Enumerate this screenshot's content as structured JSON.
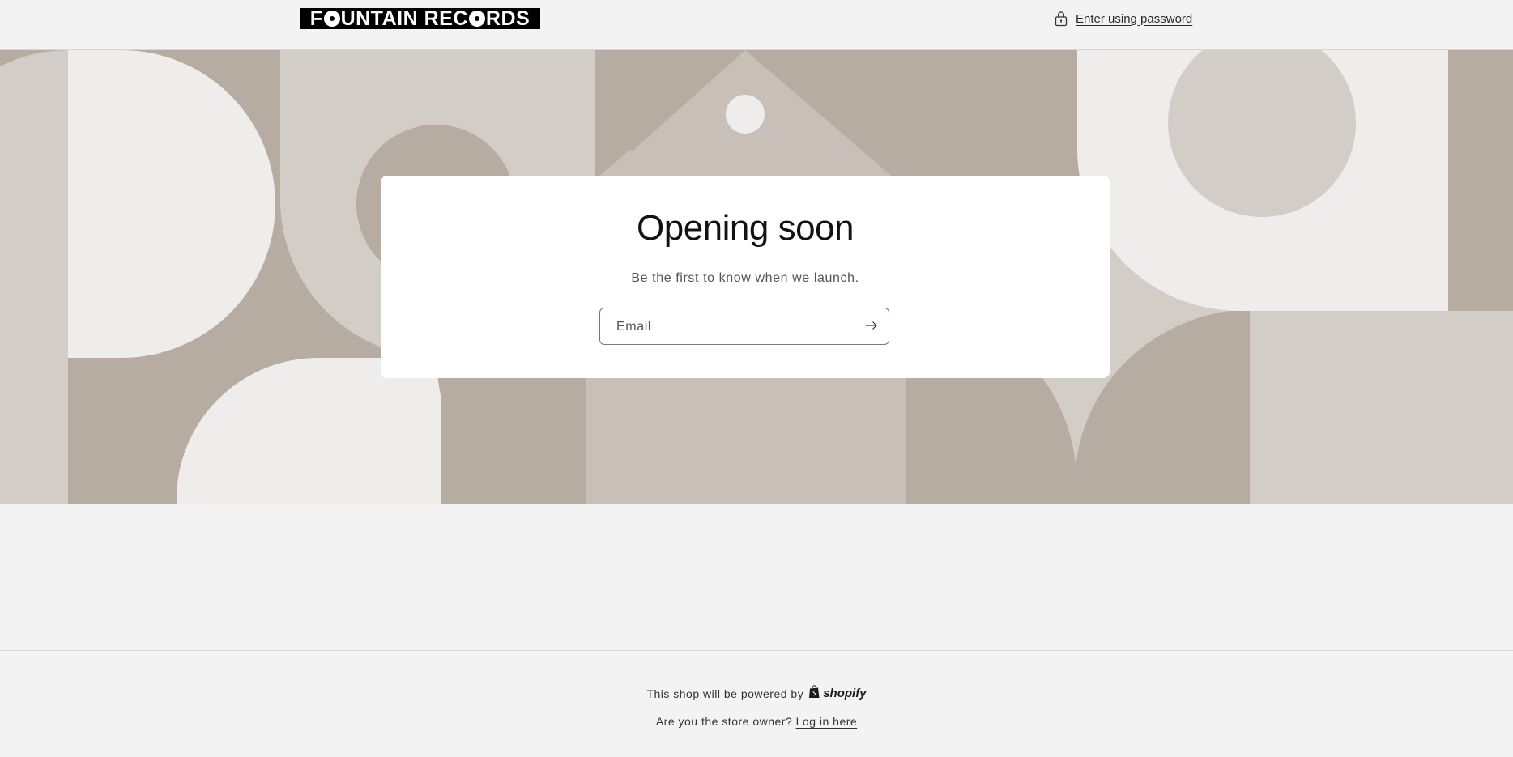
{
  "header": {
    "logo_text_pre": "F",
    "logo_text_mid": "UNTAIN REC",
    "logo_text_post": "RDS",
    "password_link_label": "Enter using password"
  },
  "card": {
    "title": "Opening soon",
    "subtitle": "Be the first to know when we launch.",
    "email_placeholder": "Email"
  },
  "footer": {
    "powered_text": "This shop will be powered by",
    "shopify_wordmark": "shopify",
    "owner_text": "Are you the store owner?",
    "login_link": "Log in here"
  },
  "colors": {
    "page_bg": "#f3f3f3",
    "banner_dark": "#b6aca1",
    "banner_mid": "#c7bfb8",
    "banner_light": "#d3cdc7",
    "banner_pale": "#eeedeb",
    "card_bg": "#ffffff"
  },
  "icons": {
    "password": "lock-icon",
    "submit": "arrow-right-icon",
    "shopify": "shopify-bag-icon"
  }
}
